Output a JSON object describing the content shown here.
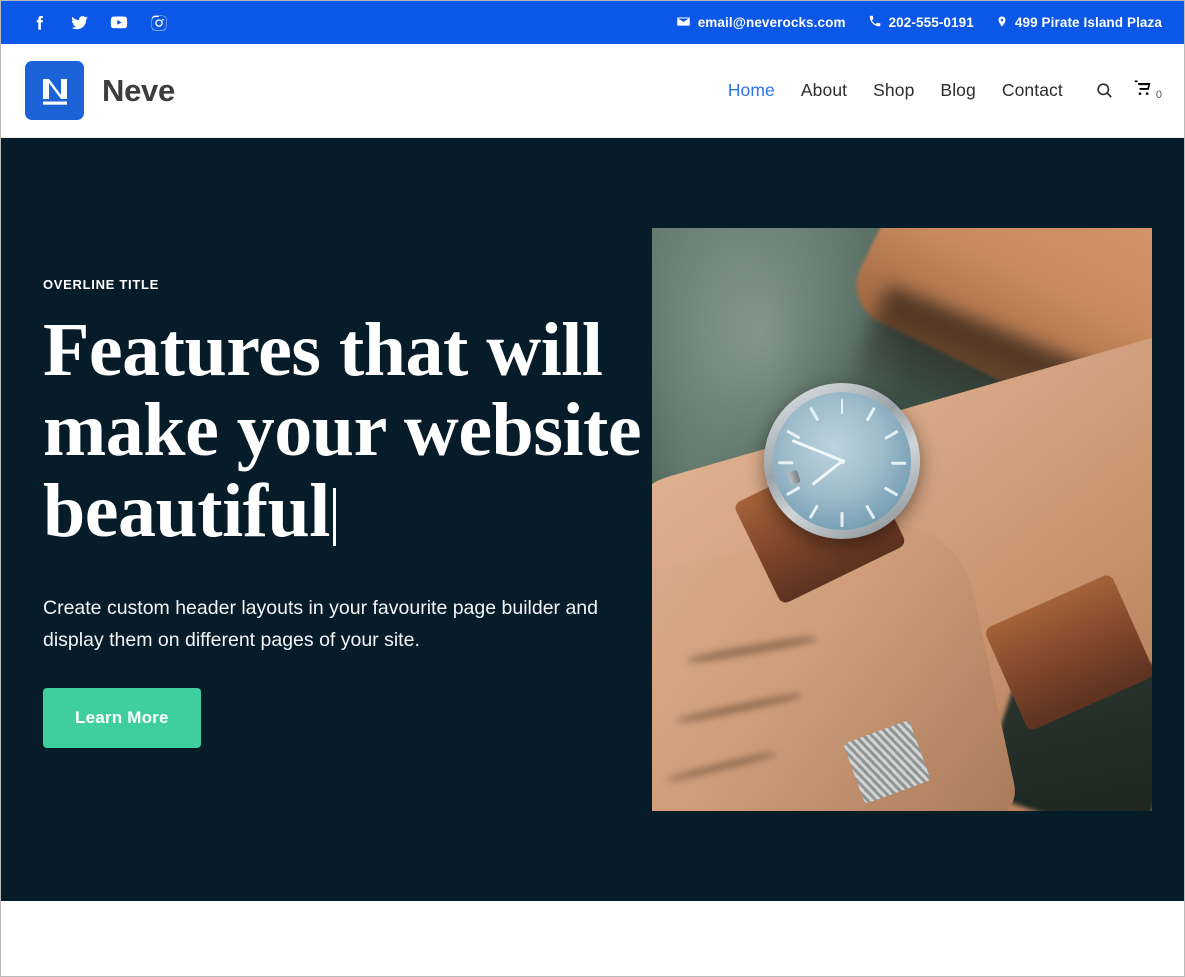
{
  "topbar": {
    "socials": [
      {
        "name": "facebook-icon",
        "label": "Facebook"
      },
      {
        "name": "twitter-icon",
        "label": "Twitter"
      },
      {
        "name": "youtube-icon",
        "label": "YouTube"
      },
      {
        "name": "instagram-icon",
        "label": "Instagram"
      }
    ],
    "contacts": {
      "email": "email@neverocks.com",
      "phone": "202-555-0191",
      "address": "499 Pirate Island Plaza"
    },
    "background_color": "#0b57e8"
  },
  "header": {
    "brand_name": "Neve",
    "logo_letter": "N",
    "nav": [
      {
        "label": "Home",
        "active": true
      },
      {
        "label": "About",
        "active": false
      },
      {
        "label": "Shop",
        "active": false
      },
      {
        "label": "Blog",
        "active": false
      },
      {
        "label": "Contact",
        "active": false
      }
    ],
    "search_label": "Search",
    "cart_count": "0",
    "active_color": "#2b74e8"
  },
  "hero": {
    "overline": "OVERLINE TITLE",
    "headline": "Features that will make your website beautiful",
    "subtitle": "Create custom header layouts in your favourite page builder and display them on different pages of your site.",
    "cta_label": "Learn More",
    "cta_color": "#3fcf9e",
    "background_color": "#071c29",
    "image_alt": "Close-up of a wrist wearing a silver watch with a blue dial and brown leather strap"
  }
}
